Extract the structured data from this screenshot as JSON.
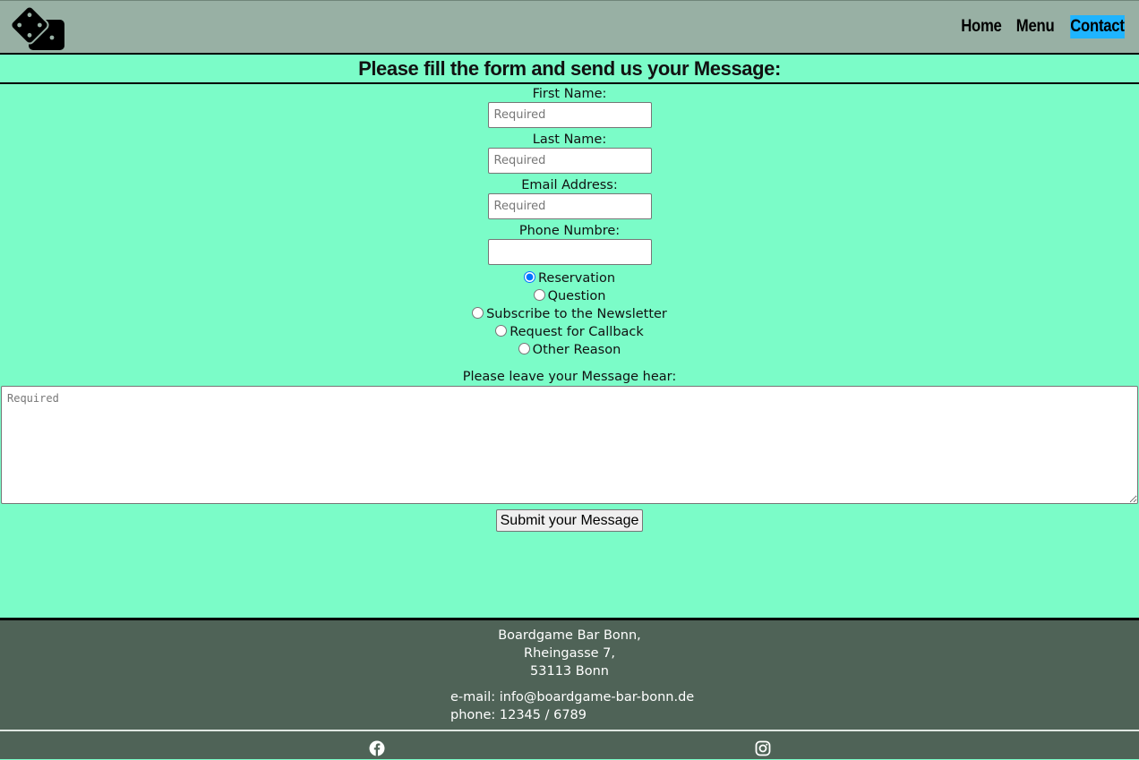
{
  "header": {
    "logo_icon": "dice-icon",
    "nav": [
      {
        "label": "Home",
        "active": false
      },
      {
        "label": "Menu",
        "active": false
      },
      {
        "label": "Contact",
        "active": true
      }
    ]
  },
  "form": {
    "title": "Please fill the form and send us your Message:",
    "fields": [
      {
        "label": "First Name:",
        "placeholder": "Required",
        "value": ""
      },
      {
        "label": "Last Name:",
        "placeholder": "Required",
        "value": ""
      },
      {
        "label": "Email Address:",
        "placeholder": "Required",
        "value": ""
      },
      {
        "label": "Phone Numbre:",
        "placeholder": "",
        "value": ""
      }
    ],
    "reasons": [
      {
        "label": "Reservation",
        "checked": true
      },
      {
        "label": "Question",
        "checked": false
      },
      {
        "label": "Subscribe to the Newsletter",
        "checked": false
      },
      {
        "label": "Request for Callback",
        "checked": false
      },
      {
        "label": "Other Reason",
        "checked": false
      }
    ],
    "message_label": "Please leave your Message hear:",
    "message_placeholder": "Required",
    "submit_label": "Submit your Message"
  },
  "footer": {
    "address_lines": [
      "Boardgame Bar Bonn,",
      "Rheingasse 7,",
      "53113 Bonn"
    ],
    "email_line": "e-mail: info@boardgame-bar-bonn.de",
    "phone_line": "phone: 12345 / 6789",
    "social_icons": [
      "facebook-icon",
      "instagram-icon"
    ]
  },
  "colors": {
    "page_bg": "#7bfcc8",
    "header_bg": "#98b0a4",
    "nav_active_bg": "#1fb4ff",
    "footer_bg": "#4f6357"
  }
}
